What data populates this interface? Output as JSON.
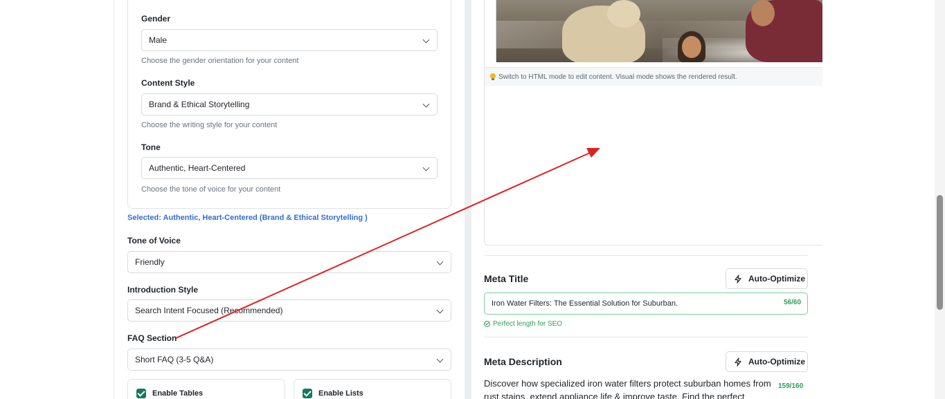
{
  "left": {
    "gender": {
      "label": "Gender",
      "value": "Male",
      "help": "Choose the gender orientation for your content"
    },
    "content_style": {
      "label": "Content Style",
      "value": "Brand & Ethical Storytelling",
      "help": "Choose the writing style for your content"
    },
    "tone": {
      "label": "Tone",
      "value": "Authentic, Heart-Centered",
      "help": "Choose the tone of voice for your content"
    },
    "selected_note": "Selected: Authentic, Heart-Centered (Brand & Ethical Storytelling )",
    "tone_of_voice": {
      "label": "Tone of Voice",
      "value": "Friendly"
    },
    "introduction_style": {
      "label": "Introduction Style",
      "value": "Search Intent Focused (Recommended)"
    },
    "faq_section": {
      "label": "FAQ Section",
      "value": "Short FAQ (3-5 Q&A)"
    },
    "enable_tables": {
      "label": "Enable Tables",
      "checked": true
    },
    "enable_lists": {
      "label": "Enable Lists",
      "checked": true
    }
  },
  "right": {
    "editor_hint": "Switch to HTML mode to edit content. Visual mode shows the rendered result.",
    "meta_title": {
      "heading": "Meta Title",
      "button": "Auto-Optimize",
      "value": "Iron Water Filters: The Essential Solution for Suburban.",
      "count": "56/60",
      "status": "Perfect length for SEO"
    },
    "meta_description": {
      "heading": "Meta Description",
      "button": "Auto-Optimize",
      "value": "Discover how specialized iron water filters protect suburban homes from rust stains, extend appliance life & improve taste. Find the perfect",
      "count": "159/160"
    }
  },
  "colors": {
    "accent_blue": "#2f6fd6",
    "success_green": "#2e9b57",
    "checkbox_green": "#147a5c",
    "annotation_red": "#e02020"
  }
}
